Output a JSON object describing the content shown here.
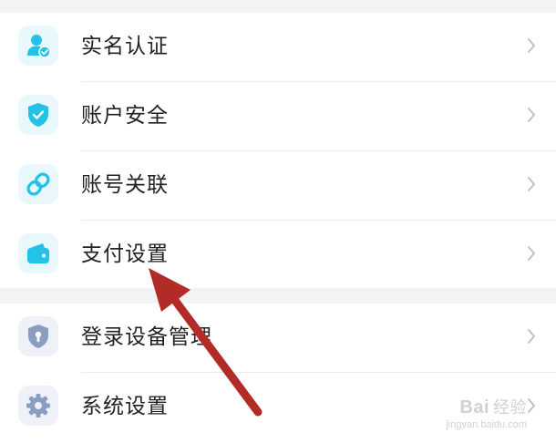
{
  "groups": [
    {
      "items": [
        {
          "label": "实名认证",
          "icon": "user-verify-icon"
        },
        {
          "label": "账户安全",
          "icon": "shield-check-icon"
        },
        {
          "label": "账号关联",
          "icon": "link-icon"
        },
        {
          "label": "支付设置",
          "icon": "wallet-icon"
        }
      ]
    },
    {
      "items": [
        {
          "label": "登录设备管理",
          "icon": "device-shield-icon"
        },
        {
          "label": "系统设置",
          "icon": "gear-icon"
        }
      ]
    }
  ],
  "chevron_icon": "chevron-right-icon",
  "annotation": {
    "type": "arrow",
    "color": "#b22b27",
    "points_to": "支付设置"
  },
  "watermark": {
    "brand": "Bai",
    "suffix": "经验",
    "url": "jingyan.baidu.com"
  },
  "colors": {
    "accent": "#2cc5e8",
    "gray_icon": "#8c9dc2",
    "arrow": "#b22b27"
  }
}
